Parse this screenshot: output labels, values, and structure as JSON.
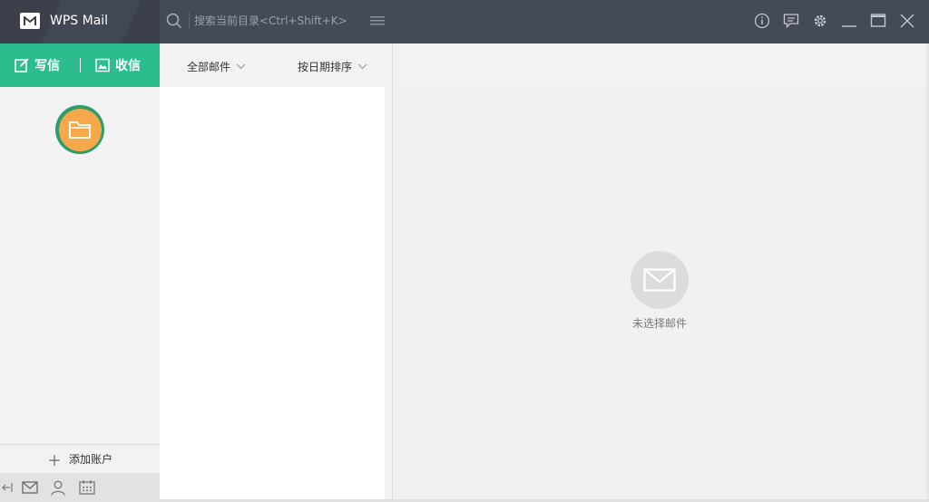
{
  "app": {
    "title": "WPS Mail"
  },
  "search": {
    "placeholder": "搜索当前目录<Ctrl+Shift+K>"
  },
  "actions": {
    "compose_label": "写信",
    "receive_label": "收信"
  },
  "sidebar": {
    "add_account_label": "添加账户"
  },
  "list": {
    "filter_label": "全部邮件",
    "sort_label": "按日期排序"
  },
  "preview": {
    "empty_text": "未选择邮件"
  },
  "icons": {
    "search": "search-icon",
    "menu": "menu-icon",
    "info": "info-icon",
    "feedback": "feedback-icon",
    "settings": "gear-icon",
    "minimize": "minimize-icon",
    "maximize": "maximize-icon",
    "close": "close-icon",
    "compose": "compose-icon",
    "receive": "inbox-icon",
    "folder": "folder-icon",
    "mail": "mail-icon",
    "contacts": "contacts-icon",
    "calendar": "calendar-icon",
    "collapse": "collapse-icon"
  },
  "colors": {
    "titlebar": "#454a57",
    "accent": "#2cbc8d",
    "folder_bg": "#f5a94a",
    "folder_ring": "#2e9d6c"
  }
}
